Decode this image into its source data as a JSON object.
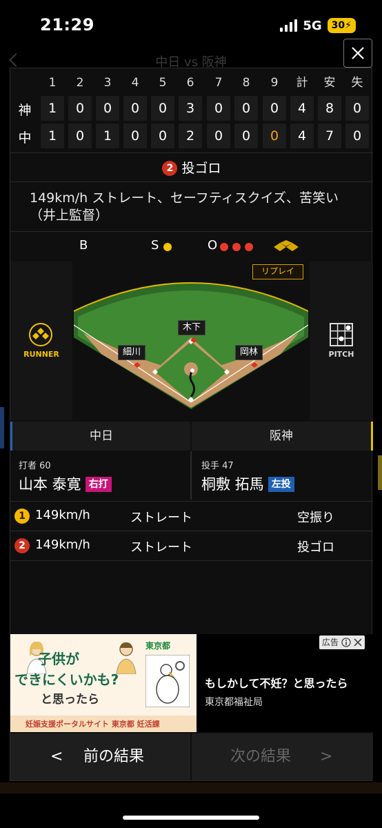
{
  "status_bar": {
    "time": "21:29",
    "network": "5G",
    "battery": "30"
  },
  "background_page": {
    "title": "中日 vs 阪神"
  },
  "icons": {
    "close": "close-icon",
    "runner": "runner-bases-icon",
    "pitch": "pitch-grid-icon",
    "ad_info": "info-icon",
    "ad_close": "close-icon"
  },
  "scoreboard": {
    "headers": [
      "1",
      "2",
      "3",
      "4",
      "5",
      "6",
      "7",
      "8",
      "9",
      "計",
      "安",
      "失"
    ],
    "rows": [
      {
        "team": "神",
        "scores": [
          "1",
          "0",
          "0",
          "0",
          "0",
          "3",
          "0",
          "0",
          "0",
          "4",
          "8",
          "0"
        ]
      },
      {
        "team": "中",
        "scores": [
          "1",
          "0",
          "1",
          "0",
          "0",
          "2",
          "0",
          "0",
          "0",
          "4",
          "7",
          "0"
        ]
      }
    ]
  },
  "play": {
    "number": "2",
    "result": "投ゴロ",
    "description": "149km/h ストレート、セーフティスクイズ、苦笑い（井上監督）"
  },
  "count": {
    "ball_label": "B",
    "strike_label": "S",
    "out_label": "O",
    "balls": 0,
    "strikes": 1,
    "outs": 3
  },
  "field": {
    "runner_label": "RUNNER",
    "pitch_label": "PITCH",
    "replay_label": "リプレイ",
    "fielders": {
      "center": "木下",
      "left": "細川",
      "right": "岡林"
    }
  },
  "teams": {
    "home": "中日",
    "away": "阪神"
  },
  "batter": {
    "role": "打者 60",
    "name": "山本 泰寛",
    "hand": "右打",
    "hand_color": "#c8157a"
  },
  "pitcher": {
    "role": "投手 47",
    "name": "桐敷 拓馬",
    "hand": "左投",
    "hand_color": "#1e5fb4"
  },
  "pitches": [
    {
      "number": "1",
      "speed": "149km/h",
      "type": "ストレート",
      "result": "空振り"
    },
    {
      "number": "2",
      "speed": "149km/h",
      "type": "ストレート",
      "result": "投ゴロ"
    }
  ],
  "ad": {
    "image_line1": "子供が",
    "image_line2": "できにくいかも?",
    "image_line3": "と思ったら",
    "image_footer": "妊娠支援ポータルサイト 東京都 妊活課",
    "image_logo": "東京都",
    "headline": "もしかして不妊？と思ったら",
    "sponsor": "東京都福祉局",
    "badge": "広告"
  },
  "navigation": {
    "prev_label": "前の結果",
    "next_label": "次の結果"
  },
  "colors": {
    "accent_yellow": "#f5b800",
    "out_red": "#d0321e",
    "field_green": "#3b7d2e"
  }
}
